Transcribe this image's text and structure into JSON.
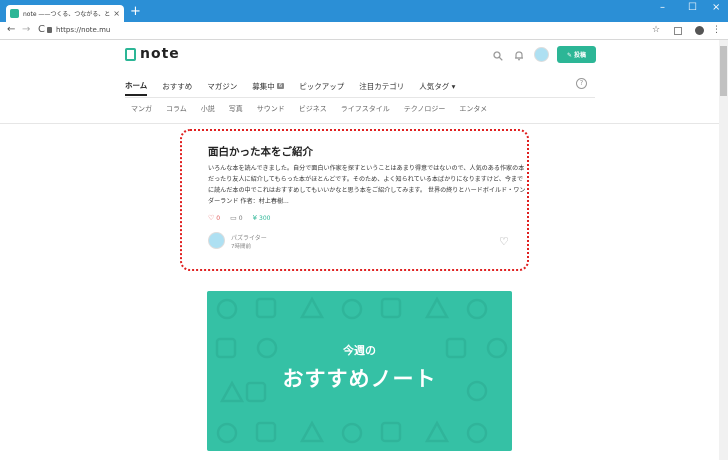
{
  "browser": {
    "tab_title": "note ——つくる、つながる、とどける。",
    "tab_close": "×",
    "new_tab": "+",
    "minimize": "–",
    "maximize": "☐",
    "close": "×",
    "back": "←",
    "forward": "→",
    "reload": "C",
    "url": "https://note.mu",
    "star": "☆",
    "menu": "⋮"
  },
  "header": {
    "logo_text": "note",
    "post_label": "✎ 投稿"
  },
  "nav": {
    "items": [
      {
        "label": "ホーム",
        "active": true
      },
      {
        "label": "おすすめ"
      },
      {
        "label": "マガジン"
      },
      {
        "label": "募集中",
        "badge": "6"
      },
      {
        "label": "ピックアップ"
      },
      {
        "label": "注目カテゴリ"
      },
      {
        "label": "人気タグ ▾"
      }
    ],
    "help": "?"
  },
  "subnav": {
    "items": [
      "マンガ",
      "コラム",
      "小説",
      "写真",
      "サウンド",
      "ビジネス",
      "ライフスタイル",
      "テクノロジー",
      "エンタメ"
    ]
  },
  "article": {
    "title": "面白かった本をご紹介",
    "body": "いろんな本を読んできました。自分で面白い作家を探すということはあまり得意ではないので、人気のある作家の本だったり友人に紹介してもらった本がほとんどです。そのため、よく知られている本ばかりになりますけど、今までに読んだ本の中でこれはおすすめしてもいいかなと思う本をご紹介してみます。 世界の終りとハードボイルド・ワンダーランド 作者：村上春樹...",
    "likes": "0",
    "comments": "0",
    "price": "300",
    "author": "パズライター",
    "time": "7時間前"
  },
  "banner": {
    "small": "今週の",
    "big": "おすすめノート"
  },
  "colors": {
    "brand": "#2cb696",
    "banner": "#35c1a5",
    "highlight": "#e02020"
  }
}
